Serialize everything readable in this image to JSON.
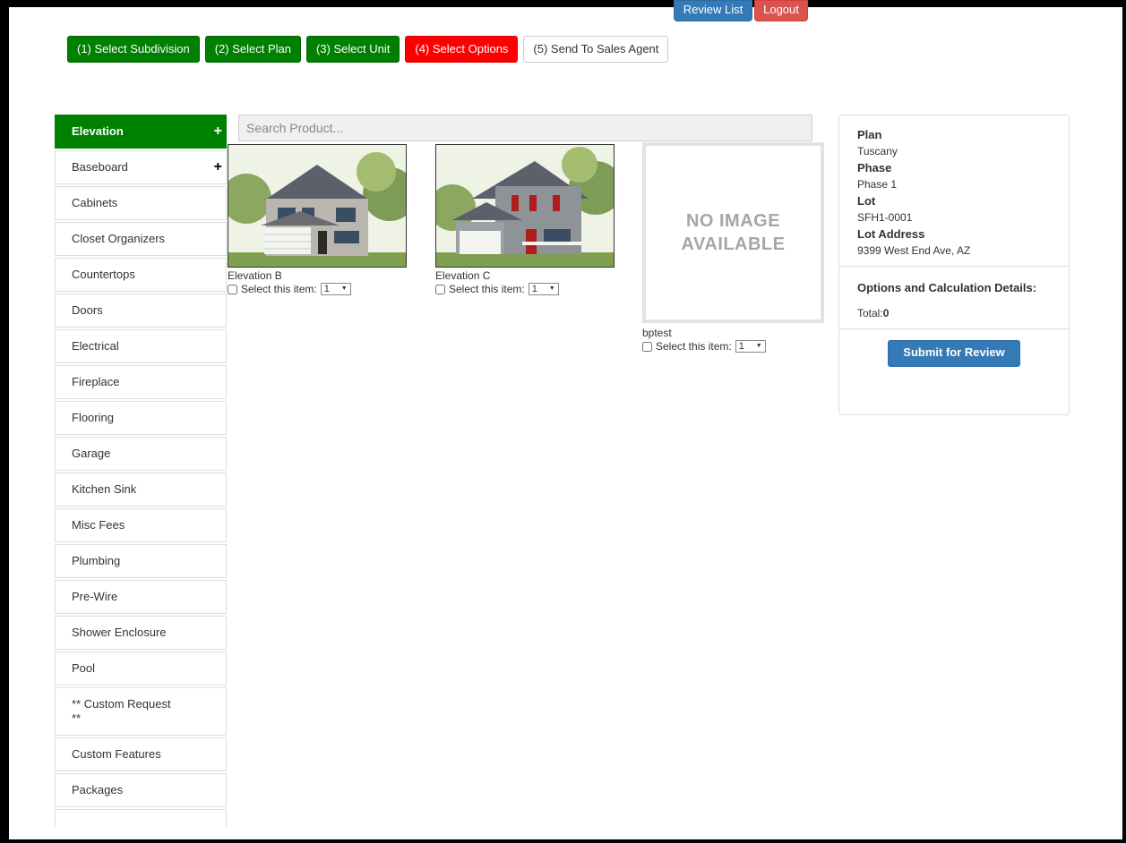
{
  "header": {
    "review_list_label": "Review List",
    "logout_label": "Logout"
  },
  "steps": [
    {
      "label": "(1) Select Subdivision",
      "state": "done"
    },
    {
      "label": "(2) Select Plan",
      "state": "done"
    },
    {
      "label": "(3) Select Unit",
      "state": "done"
    },
    {
      "label": "(4) Select Options",
      "state": "current"
    },
    {
      "label": "(5) Send To Sales Agent",
      "state": "todo"
    }
  ],
  "sidebar": {
    "items": [
      {
        "label": "Elevation",
        "expandable": true,
        "active": true
      },
      {
        "label": "Baseboard",
        "expandable": true
      },
      {
        "label": "Cabinets"
      },
      {
        "label": "Closet Organizers"
      },
      {
        "label": "Countertops"
      },
      {
        "label": "Doors"
      },
      {
        "label": "Electrical"
      },
      {
        "label": "Fireplace"
      },
      {
        "label": "Flooring"
      },
      {
        "label": "Garage"
      },
      {
        "label": "Kitchen Sink"
      },
      {
        "label": "Misc Fees"
      },
      {
        "label": "Plumbing"
      },
      {
        "label": "Pre-Wire"
      },
      {
        "label": "Shower Enclosure"
      },
      {
        "label": "Pool"
      },
      {
        "label": "** Custom Request\n**"
      },
      {
        "label": "Custom Features"
      },
      {
        "label": "Packages"
      }
    ],
    "plus_glyph": "+"
  },
  "search": {
    "placeholder": "Search Product..."
  },
  "products": [
    {
      "name": "Elevation B",
      "select_label": "Select this item:",
      "qty": "1",
      "image": "house-elevation-b"
    },
    {
      "name": "Elevation C",
      "select_label": "Select this item:",
      "qty": "1",
      "image": "house-elevation-c"
    },
    {
      "name": "bptest",
      "select_label": "Select this item:",
      "qty": "1",
      "no_image_text": "NO IMAGE AVAILABLE"
    }
  ],
  "summary": {
    "plan_label": "Plan",
    "plan_value": "Tuscany",
    "phase_label": "Phase",
    "phase_value": "Phase 1",
    "lot_label": "Lot",
    "lot_value": "SFH1-0001",
    "address_label": "Lot Address",
    "address_value": "9399 West End Ave, AZ",
    "options_label": "Options and Calculation Details:",
    "total_label": "Total:",
    "total_value": "0",
    "submit_label": "Submit for Review"
  },
  "colors": {
    "done": "#008000",
    "current": "#ff0000",
    "primary": "#337ab7",
    "danger": "#d9534f"
  }
}
